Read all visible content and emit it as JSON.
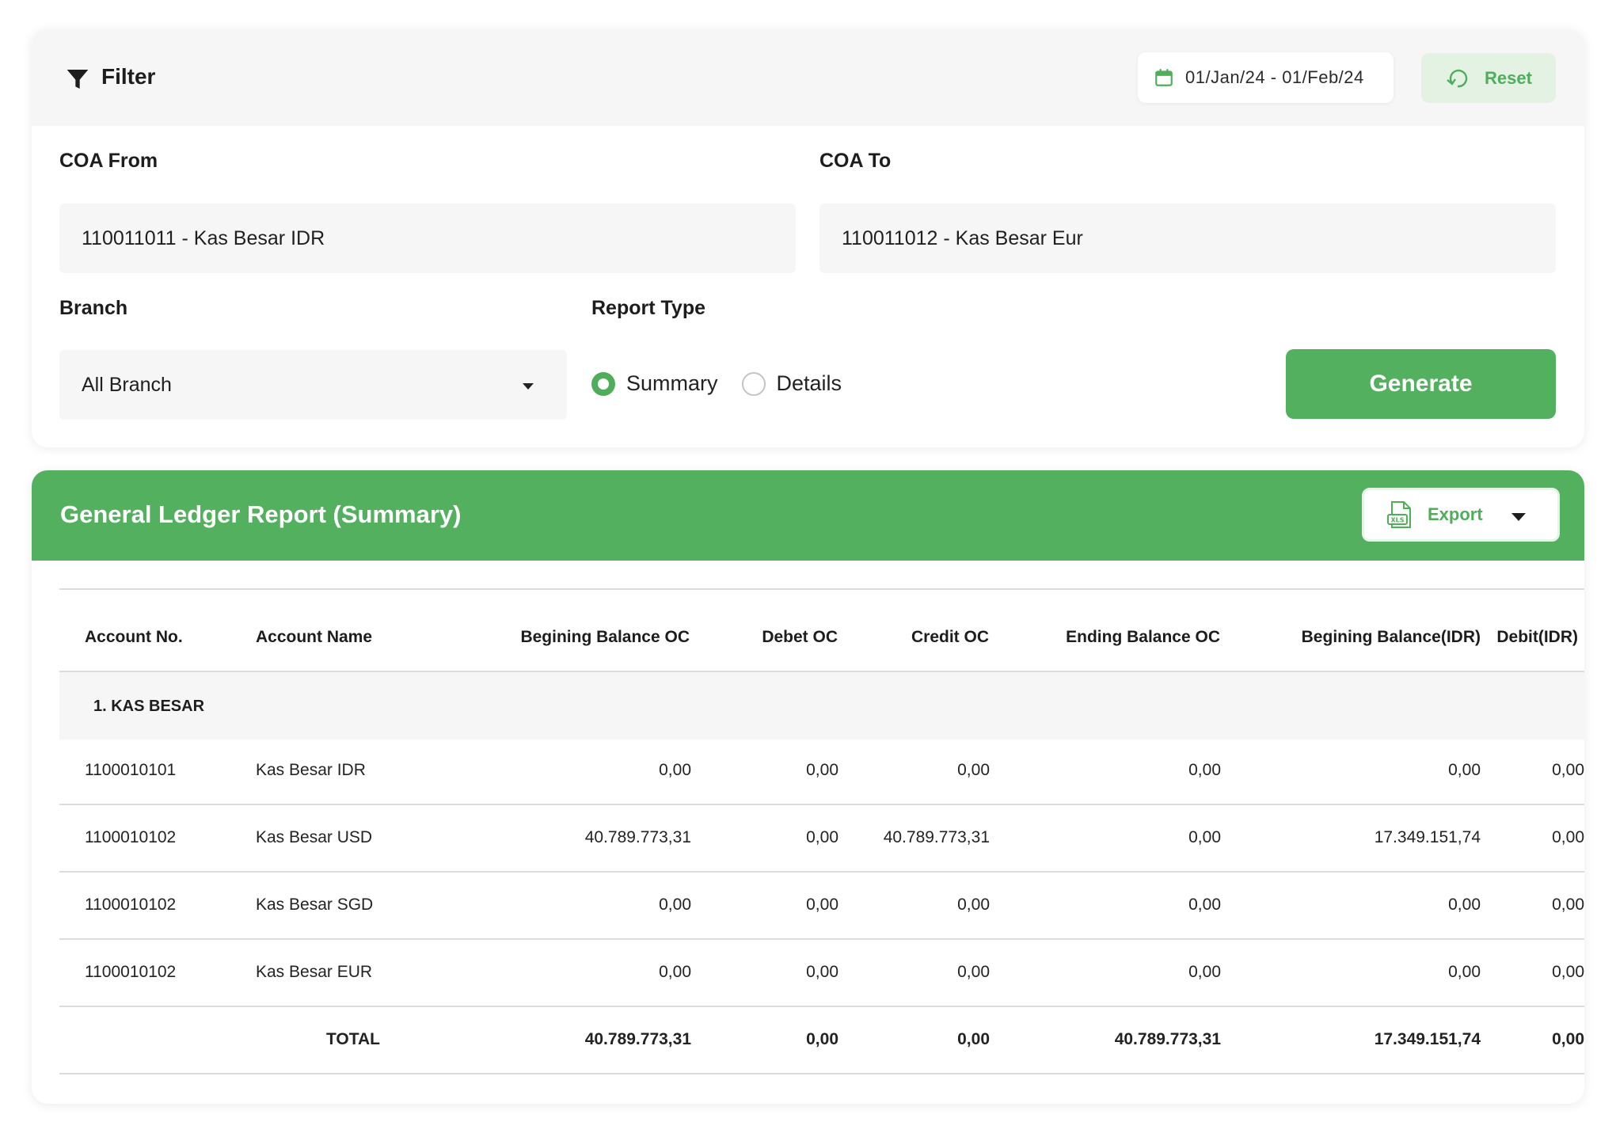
{
  "filter": {
    "title": "Filter",
    "date_range": "01/Jan/24 - 01/Feb/24",
    "reset_label": "Reset",
    "coa_from": {
      "label": "COA From",
      "value": "110011011 - Kas Besar IDR"
    },
    "coa_to": {
      "label": "COA To",
      "value": "110011012 - Kas Besar Eur"
    },
    "branch": {
      "label": "Branch",
      "value": "All Branch"
    },
    "report_type": {
      "label": "Report Type",
      "options": [
        "Summary",
        "Details"
      ],
      "selected": "Summary"
    },
    "generate_label": "Generate"
  },
  "report": {
    "title": "General Ledger Report (Summary)",
    "export_label": "Export",
    "columns": [
      "Account No.",
      "Account Name",
      "Begining Balance OC",
      "Debet OC",
      "Credit OC",
      "Ending Balance OC",
      "Begining Balance(IDR)",
      "Debit(IDR)"
    ],
    "group": "1. KAS BESAR",
    "rows": [
      [
        "1100010101",
        "Kas Besar IDR",
        "0,00",
        "0,00",
        "0,00",
        "0,00",
        "0,00",
        "0,00"
      ],
      [
        "1100010102",
        "Kas Besar USD",
        "40.789.773,31",
        "0,00",
        "40.789.773,31",
        "0,00",
        "17.349.151,74",
        "0,00"
      ],
      [
        "1100010102",
        "Kas Besar SGD",
        "0,00",
        "0,00",
        "0,00",
        "0,00",
        "0,00",
        "0,00"
      ],
      [
        "1100010102",
        "Kas Besar EUR",
        "0,00",
        "0,00",
        "0,00",
        "0,00",
        "0,00",
        "0,00"
      ]
    ],
    "total": [
      "",
      "TOTAL",
      "40.789.773,31",
      "0,00",
      "0,00",
      "40.789.773,31",
      "17.349.151,74",
      "0,00"
    ]
  },
  "colors": {
    "accent": "#53b05e",
    "accent_light": "#e3f2e3",
    "panel_bg": "#f6f6f6"
  },
  "icons": [
    "filter-icon",
    "calendar-icon",
    "reset-icon",
    "caret-down-icon",
    "xls-file-icon",
    "chevron-down-icon"
  ]
}
